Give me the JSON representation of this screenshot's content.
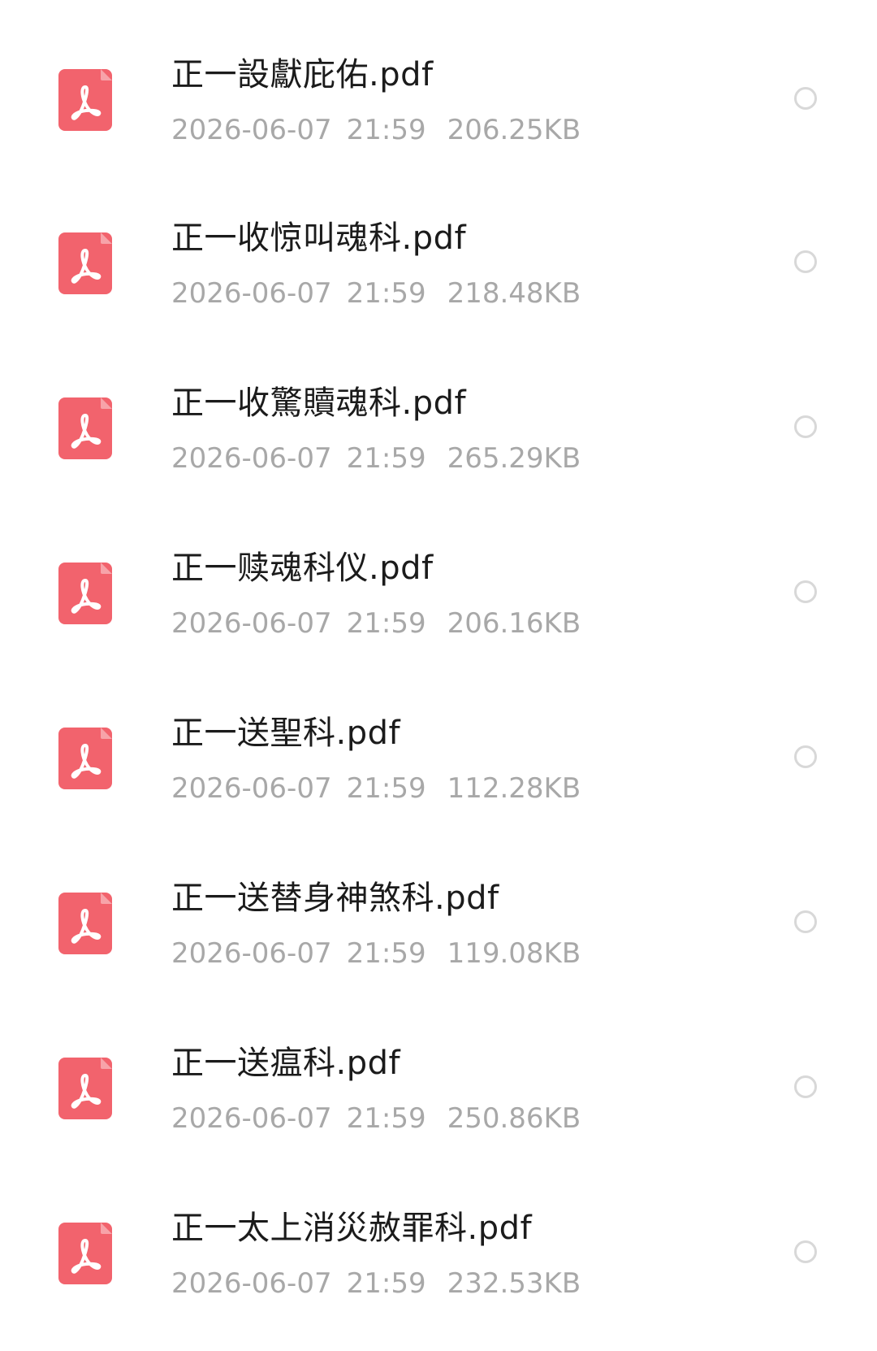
{
  "colors": {
    "pdf_icon": "#f2636d",
    "file_name": "#1b1b1b",
    "meta_text": "#a8a8a8",
    "radio_border": "#d8d8d8"
  },
  "icons": {
    "file_type": "pdf-icon",
    "select": "radio-unchecked-icon"
  },
  "files": [
    {
      "name": "正一設獻庇佑.pdf",
      "date": "2026-06-07",
      "time": "21:59",
      "size": "206.25KB"
    },
    {
      "name": "正一收惊叫魂科.pdf",
      "date": "2026-06-07",
      "time": "21:59",
      "size": "218.48KB"
    },
    {
      "name": "正一收驚贖魂科.pdf",
      "date": "2026-06-07",
      "time": "21:59",
      "size": "265.29KB"
    },
    {
      "name": "正一赎魂科仪.pdf",
      "date": "2026-06-07",
      "time": "21:59",
      "size": "206.16KB"
    },
    {
      "name": "正一送聖科.pdf",
      "date": "2026-06-07",
      "time": "21:59",
      "size": "112.28KB"
    },
    {
      "name": "正一送替身神煞科.pdf",
      "date": "2026-06-07",
      "time": "21:59",
      "size": "119.08KB"
    },
    {
      "name": "正一送瘟科.pdf",
      "date": "2026-06-07",
      "time": "21:59",
      "size": "250.86KB"
    },
    {
      "name": "正一太上消災赦罪科.pdf",
      "date": "2026-06-07",
      "time": "21:59",
      "size": "232.53KB"
    }
  ]
}
